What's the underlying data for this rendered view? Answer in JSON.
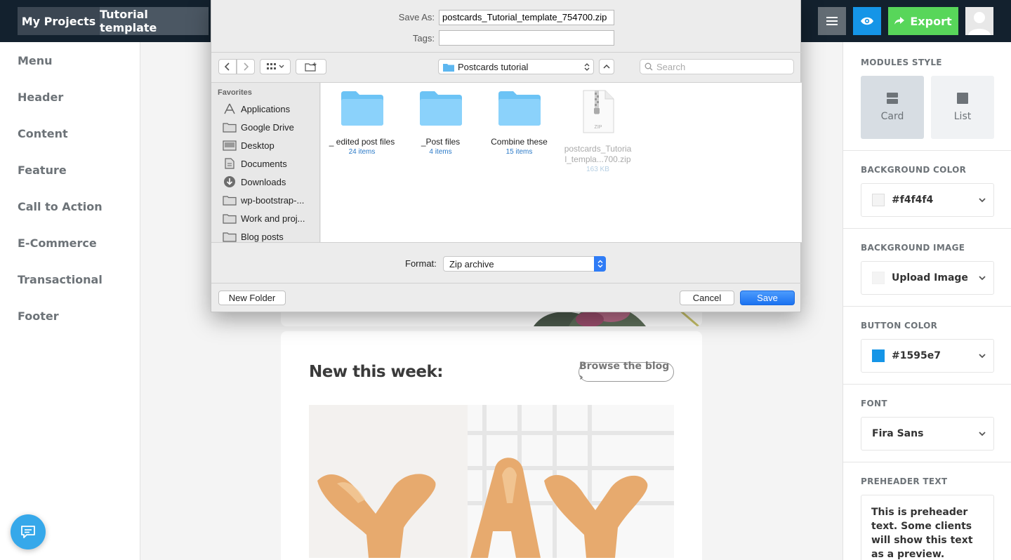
{
  "topbar": {
    "tabs": [
      "My Projects",
      "Tutorial template"
    ],
    "export_label": "Export",
    "colors": {
      "bg": "#13212e",
      "eye_btn": "#1595e7",
      "export_btn": "#58d65a"
    }
  },
  "sidebar": {
    "items": [
      "Menu",
      "Header",
      "Content",
      "Feature",
      "Call to Action",
      "E-Commerce",
      "Transactional",
      "Footer"
    ]
  },
  "canvas": {
    "heading": "New this week:",
    "browse_label": "Browse the blog ›"
  },
  "right_panel": {
    "modules_style_label": "MODULES STYLE",
    "style_options": [
      "Card",
      "List"
    ],
    "background_color_label": "BACKGROUND COLOR",
    "background_color_value": "#f4f4f4",
    "background_image_label": "BACKGROUND IMAGE",
    "background_image_value": "Upload Image",
    "button_color_label": "BUTTON COLOR",
    "button_color_value": "#1595e7",
    "font_label": "FONT",
    "font_value": "Fira Sans",
    "preheader_label": "PREHEADER TEXT",
    "preheader_text": "This is preheader text. Some clients will show this text as a preview."
  },
  "dialog": {
    "save_as_label": "Save As:",
    "save_as_value": "postcards_Tutorial_template_754700.zip",
    "tags_label": "Tags:",
    "tags_value": "",
    "location": "Postcards tutorial",
    "search_placeholder": "Search",
    "favorites_title": "Favorites",
    "favorites": [
      {
        "label": "Applications",
        "icon": "applications-icon"
      },
      {
        "label": "Google Drive",
        "icon": "folder-icon"
      },
      {
        "label": "Desktop",
        "icon": "desktop-icon"
      },
      {
        "label": "Documents",
        "icon": "documents-icon"
      },
      {
        "label": "Downloads",
        "icon": "downloads-icon"
      },
      {
        "label": "wp-bootstrap-...",
        "icon": "folder-icon"
      },
      {
        "label": "Work and proj...",
        "icon": "folder-icon"
      },
      {
        "label": "Blog posts",
        "icon": "folder-icon"
      }
    ],
    "files": [
      {
        "name": "_ edited post files",
        "meta": "24 items",
        "type": "folder"
      },
      {
        "name": "_Post files",
        "meta": "4 items",
        "type": "folder"
      },
      {
        "name": "Combine these",
        "meta": "15 items",
        "type": "folder"
      },
      {
        "name_line1": "postcards_Tutoria",
        "name_line2": "l_templa...700.zip",
        "meta": "163 KB",
        "type": "zip",
        "badge": "ZIP"
      }
    ],
    "format_label": "Format:",
    "format_value": "Zip archive",
    "new_folder_label": "New Folder",
    "cancel_label": "Cancel",
    "save_label": "Save"
  }
}
